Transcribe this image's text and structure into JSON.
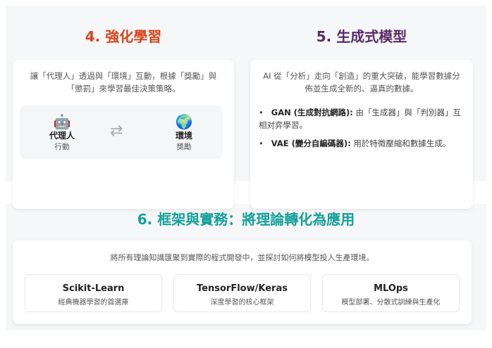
{
  "rl": {
    "title": "4. 強化學習",
    "desc": "讓「代理人」透過與「環境」互動，根據「獎勵」與「懲罰」來學習最佳決策策略。",
    "agent": {
      "icon": "🤖",
      "name": "代理人",
      "sub": "行動"
    },
    "arrow": "⇄",
    "env": {
      "icon": "🌍",
      "name": "環境",
      "sub": "獎勵"
    },
    "color": "#d6451b"
  },
  "gen": {
    "title": "5. 生成式模型",
    "desc": "AI 從「分析」走向「創造」的重大突破，能學習數據分佈並生成全新的、逼真的數據。",
    "items": [
      {
        "term": "GAN (生成對抗網路):",
        "text": " 由「生成器」與「判別器」互相对弈學習。"
      },
      {
        "term": "VAE (變分自編碼器):",
        "text": " 用於特徵壓縮和數據生成。"
      }
    ],
    "color": "#5a2a68"
  },
  "fw": {
    "title": "6. 框架與實務：將理論轉化為應用",
    "desc": "將所有理論知識匯聚到實際的程式開發中，並探討如何將模型投入生產環境。",
    "items": [
      {
        "name": "Scikit-Learn",
        "sub": "經典機器學習的首選庫"
      },
      {
        "name": "TensorFlow/Keras",
        "sub": "深度學習的核心框架"
      },
      {
        "name": "MLOps",
        "sub": "模型部署、分散式訓練與生產化"
      }
    ],
    "color": "#14a09a"
  }
}
